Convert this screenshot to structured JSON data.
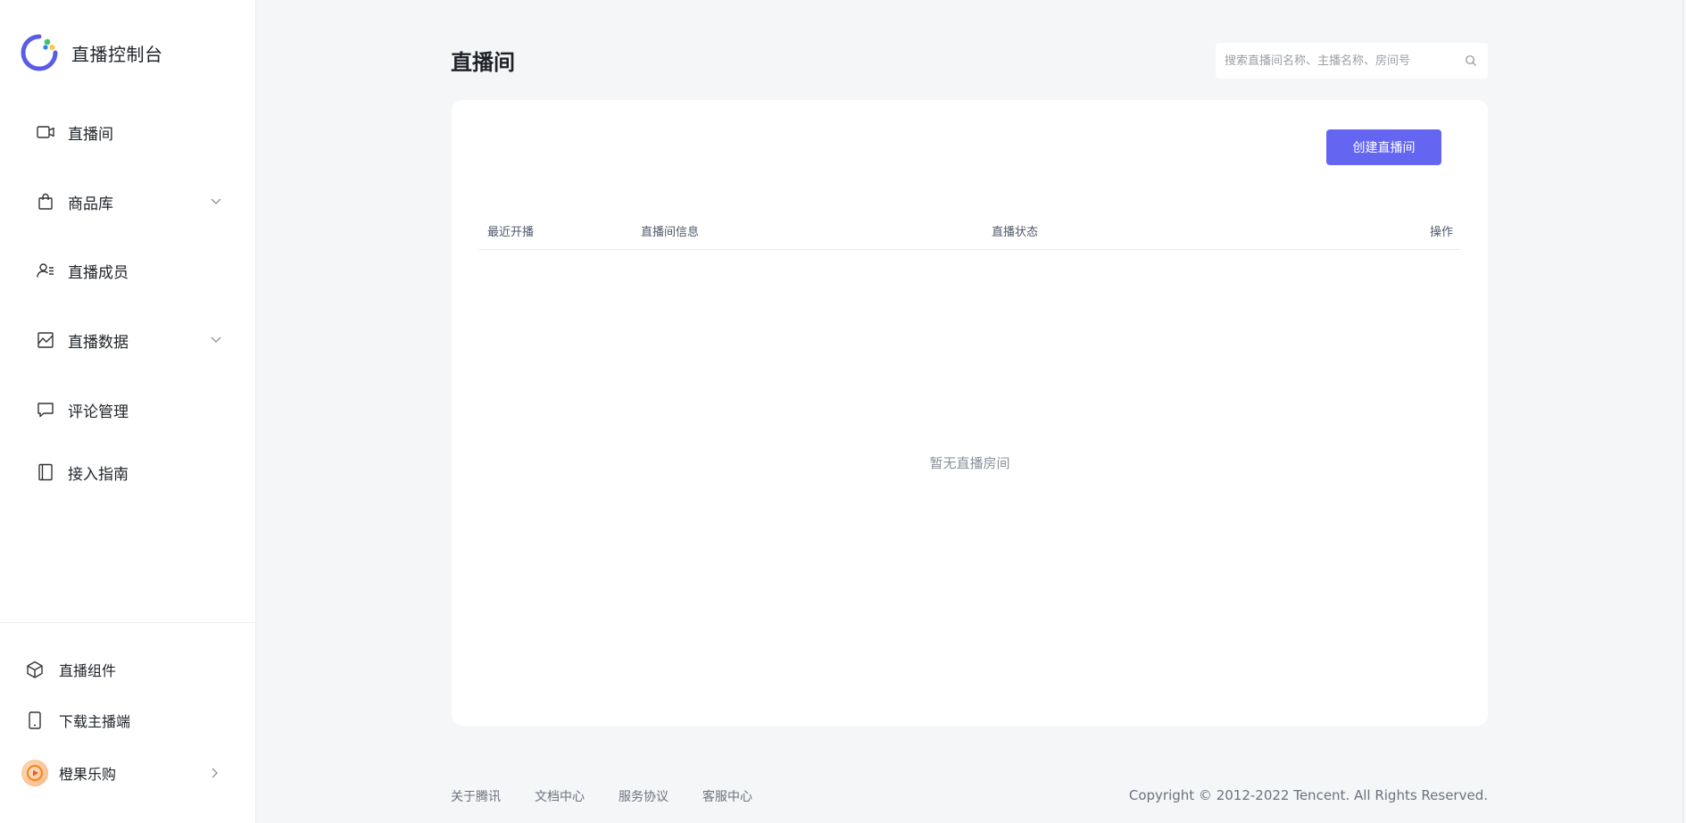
{
  "app": {
    "title": "直播控制台",
    "accent_color": "#6466f1"
  },
  "sidebar": {
    "items": [
      {
        "label": "直播间",
        "icon": "video-camera-icon",
        "expandable": false
      },
      {
        "label": "商品库",
        "icon": "shopping-bag-icon",
        "expandable": true
      },
      {
        "label": "直播成员",
        "icon": "user-list-icon",
        "expandable": false
      },
      {
        "label": "直播数据",
        "icon": "chart-icon",
        "expandable": true
      },
      {
        "label": "评论管理",
        "icon": "comment-icon",
        "expandable": false
      },
      {
        "label": "接入指南",
        "icon": "book-icon",
        "expandable": false
      }
    ],
    "bottom": {
      "component": {
        "label": "直播组件",
        "icon": "cube-icon"
      },
      "download": {
        "label": "下载主播端",
        "icon": "phone-icon"
      },
      "account": {
        "label": "橙果乐购",
        "icon": "avatar-icon"
      }
    }
  },
  "main": {
    "title": "直播间",
    "search": {
      "placeholder": "搜索直播间名称、主播名称、房间号",
      "value": ""
    },
    "create_button": "创建直播间",
    "table": {
      "columns": [
        "最近开播",
        "直播间信息",
        "直播状态",
        "操作"
      ],
      "rows": [],
      "empty_text": "暂无直播房间"
    }
  },
  "footer": {
    "links": [
      "关于腾讯",
      "文档中心",
      "服务协议",
      "客服中心"
    ],
    "copyright": "Copyright © 2012-2022 Tencent. All Rights Reserved."
  }
}
